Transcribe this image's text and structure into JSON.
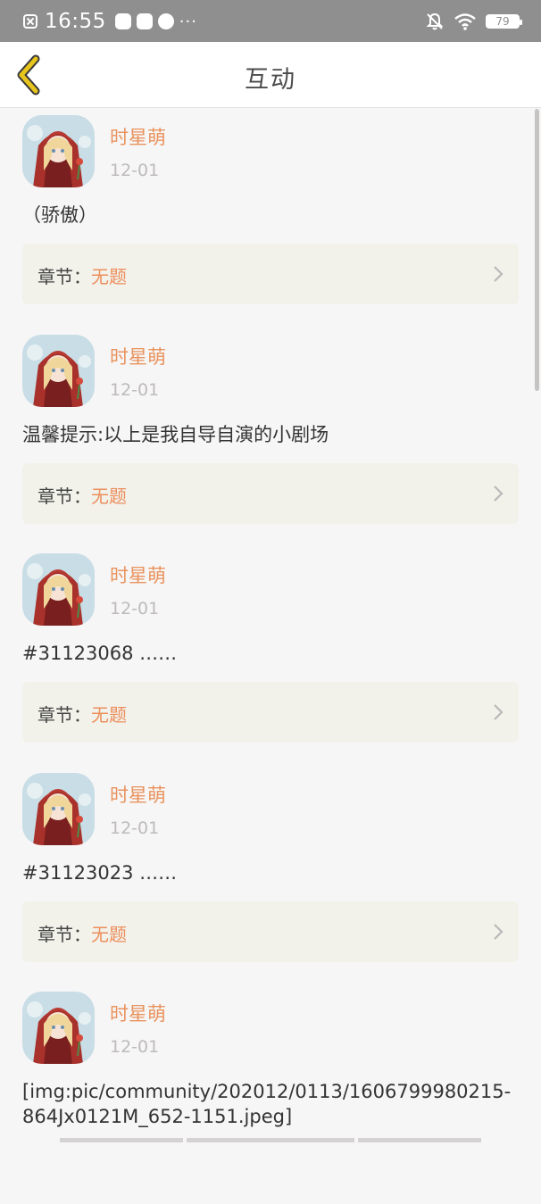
{
  "status_bar": {
    "time": "16:55",
    "battery": "79",
    "icons": [
      "close-notification-icon",
      "video-app-icon",
      "mail-app-icon",
      "browser-app-icon",
      "more-dots-icon",
      "bell-muted-icon",
      "wifi-icon",
      "battery-icon"
    ],
    "dots": "···"
  },
  "header": {
    "title": "互动",
    "back_icon": "chevron-left-icon"
  },
  "colors": {
    "accent": "#e8935e",
    "back_icon": "#e8c51d",
    "card_bg": "#f2f2eb"
  },
  "chapter_prefix": "章节：",
  "comments": [
    {
      "user": "时星萌",
      "date": "12-01",
      "content": "（骄傲）",
      "chapter": "无题"
    },
    {
      "user": "时星萌",
      "date": "12-01",
      "content": "温馨提示:以上是我自导自演的小剧场",
      "chapter": "无题"
    },
    {
      "user": "时星萌",
      "date": "12-01",
      "content": "#31123068 ……",
      "chapter": "无题"
    },
    {
      "user": "时星萌",
      "date": "12-01",
      "content": "#31123023 ……",
      "chapter": "无题"
    },
    {
      "user": "时星萌",
      "date": "12-01",
      "content": "[img:pic/community/202012/0113/1606799980215-864Jx0121M_652-1151.jpeg]",
      "chapter": ""
    }
  ]
}
